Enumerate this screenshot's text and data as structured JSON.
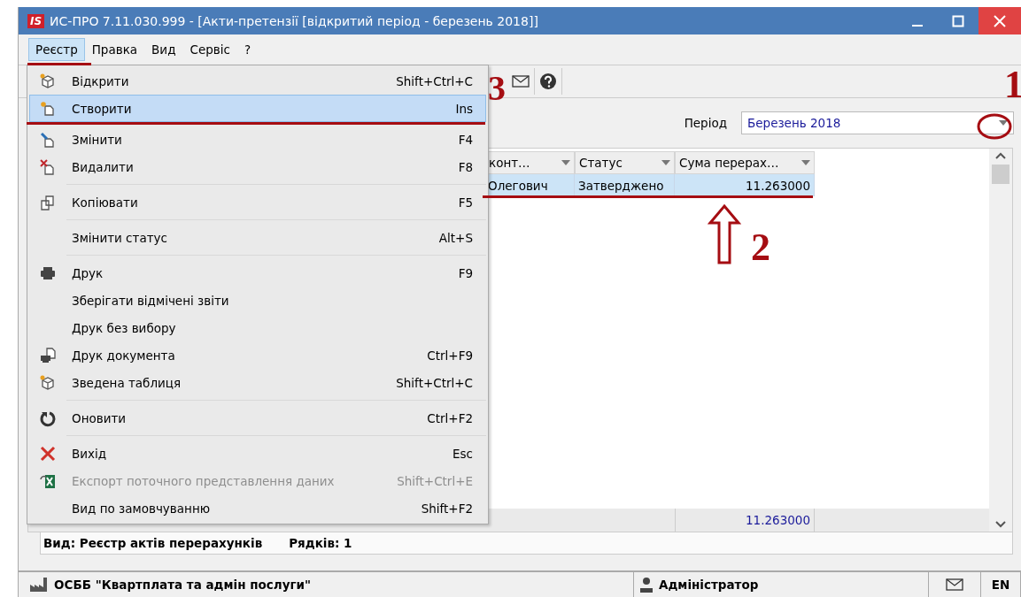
{
  "window": {
    "logo": "IS",
    "title": "ИС-ПРО 7.11.030.999 - [Акти-претензії [відкритий період - березень 2018]]"
  },
  "menu_bar": [
    {
      "label": "Реєстр",
      "selected": true
    },
    {
      "label": "Правка",
      "selected": false
    },
    {
      "label": "Вид",
      "selected": false
    },
    {
      "label": "Сервіс",
      "selected": false
    },
    {
      "label": "?",
      "selected": false
    }
  ],
  "menu": [
    {
      "label": "Відкрити",
      "shortcut": "Shift+Ctrl+C",
      "selected": false,
      "disabled": false,
      "separator_after": false
    },
    {
      "label": "Створити",
      "shortcut": "Ins",
      "selected": true,
      "disabled": false,
      "separator_after": false
    },
    {
      "label": "Змінити",
      "shortcut": "F4",
      "selected": false,
      "disabled": false,
      "separator_after": false
    },
    {
      "label": "Видалити",
      "shortcut": "F8",
      "selected": false,
      "disabled": false,
      "separator_after": true
    },
    {
      "label": "Копіювати",
      "shortcut": "F5",
      "selected": false,
      "disabled": false,
      "separator_after": true
    },
    {
      "label": "Змінити статус",
      "shortcut": "Alt+S",
      "selected": false,
      "disabled": false,
      "separator_after": true
    },
    {
      "label": "Друк",
      "shortcut": "F9",
      "selected": false,
      "disabled": false,
      "separator_after": false
    },
    {
      "label": "Зберігати відмічені звіти",
      "selected": false,
      "disabled": false,
      "separator_after": false
    },
    {
      "label": "Друк без вибору",
      "selected": false,
      "disabled": false,
      "separator_after": false
    },
    {
      "label": "Друк документа",
      "shortcut": "Ctrl+F9",
      "selected": false,
      "disabled": false,
      "separator_after": false
    },
    {
      "label": "Зведена таблиця",
      "shortcut": "Shift+Ctrl+C",
      "selected": false,
      "disabled": false,
      "separator_after": true
    },
    {
      "label": "Оновити",
      "shortcut": "Ctrl+F2",
      "selected": false,
      "disabled": false,
      "separator_after": true
    },
    {
      "label": "Вихід",
      "shortcut": "Esc",
      "selected": false,
      "disabled": false,
      "separator_after": false
    },
    {
      "label": "Експорт поточного представлення даних",
      "shortcut": "Shift+Ctrl+E",
      "selected": false,
      "disabled": true,
      "separator_after": false
    },
    {
      "label": "Вид по замовчуванню",
      "shortcut": "Shift+F2",
      "selected": false,
      "disabled": false,
      "separator_after": false
    }
  ],
  "filter": {
    "label": "Період",
    "value": "Березень 2018"
  },
  "table": {
    "columns": [
      "конт…",
      "Статус",
      "Сума перерах…"
    ],
    "rows": [
      {
        "cells": [
          "Олегович",
          "Затверджено",
          "11.263000"
        ],
        "selected": true
      }
    ],
    "totals": [
      "11.263000"
    ]
  },
  "view_status": {
    "view": "Вид: Реєстр актів перерахунків",
    "rows": "Рядків: 1"
  },
  "status_bar": {
    "organization": "ОСББ \"Квартплата та адмін послуги\"",
    "user": "Адміністратор",
    "language": "EN"
  },
  "annotations": [
    "1",
    "2",
    "3"
  ]
}
